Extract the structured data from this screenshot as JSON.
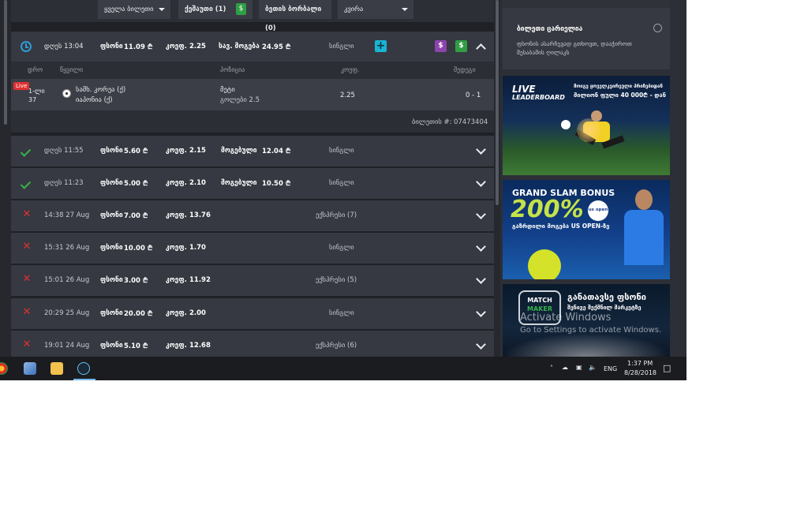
{
  "filters": [
    {
      "label": "ყველა ბილეთი"
    },
    {
      "label": "ქეშაუთი (1)"
    },
    {
      "label": "ბეთის ბორბალი (0)"
    },
    {
      "label": "კვირა"
    }
  ],
  "open_ticket": {
    "time": "დღეს 13:04",
    "stake_label": "ფსონი",
    "stake": "11.09 ₾",
    "odds_label": "კოეფ.",
    "odds": "2.25",
    "potential_label": "სავ. მოგება",
    "potential": "24.95 ₾",
    "type": "სინგლი",
    "columns": [
      "დრო",
      "წყვილი",
      "პოზიცია",
      "კოეფ.",
      "შედეგი"
    ],
    "match": {
      "live_badge": "Live",
      "period": "1-ლი",
      "minute": "37",
      "team1": "სამხ. კორეა (ქ)",
      "team2": "იაპონია (ქ)",
      "market": "მეტი",
      "selection": "გოლები 2.5",
      "odds": "2.25",
      "score": "0 - 1"
    },
    "ticket_label": "ბილეთის #:",
    "ticket_number": "07473404"
  },
  "tickets": [
    {
      "status": "won",
      "time": "დღეს 11:55",
      "stake": "5.60 ₾",
      "odds": "2.15",
      "result_label": "მოგებული",
      "result": "12.04 ₾",
      "type": "სინგლი"
    },
    {
      "status": "won",
      "time": "დღეს 11:23",
      "stake": "5.00 ₾",
      "odds": "2.10",
      "result_label": "მოგებული",
      "result": "10.50 ₾",
      "type": "სინგლი"
    },
    {
      "status": "lost",
      "time": "14:38 27 Aug",
      "stake": "7.00 ₾",
      "odds": "13.76",
      "result_label": "",
      "result": "",
      "type": "ექსპრესი (7)"
    },
    {
      "status": "lost",
      "time": "15:31 26 Aug",
      "stake": "10.00 ₾",
      "odds": "1.70",
      "result_label": "",
      "result": "",
      "type": "სინგლი"
    },
    {
      "status": "lost",
      "time": "15:01 26 Aug",
      "stake": "3.00 ₾",
      "odds": "11.92",
      "result_label": "",
      "result": "",
      "type": "ექსპრესი (5)"
    },
    {
      "status": "lost",
      "time": "20:29 25 Aug",
      "stake": "20.00 ₾",
      "odds": "2.00",
      "result_label": "",
      "result": "",
      "type": "სინგლი"
    },
    {
      "status": "lost",
      "time": "19:01 24 Aug",
      "stake": "5.10 ₾",
      "odds": "12.68",
      "result_label": "",
      "result": "",
      "type": "ექსპრესი (6)"
    }
  ],
  "stake_label": "ფსონი",
  "odds_label": "კოეფ.",
  "side": {
    "cart_title": "ბილეთი ცარიელია",
    "cart_text1": "ფსონის ასარჩევად გთხოვთ, დააჭიროთ",
    "cart_text2": "შესაბამის ღილაკს",
    "banner1_line1": "LIVE",
    "banner1_line2": "LEADERBOARD",
    "banner1_text1": "მოიგე ყოველკვირეული პრიზებიდან",
    "banner1_text2": "მილიონ ფული 40 000₾ - დან",
    "banner2_title": "GRAND SLAM BONUS",
    "banner2_percent": "200%",
    "banner2_badge": "us open",
    "banner2_sub": "გაზრდილი მოგება US OPEN-ზე",
    "banner3_logo1": "MATCH",
    "banner3_logo2": "MAKER",
    "banner3_title": "განათავსე ფსონი",
    "banner3_sub1": "შენივე შექმნილ მარკეტზე"
  },
  "watermark": {
    "line1": "Activate Windows",
    "line2": "Go to Settings to activate Windows."
  },
  "taskbar": {
    "lang": "ENG",
    "time": "1:37 PM",
    "date": "8/28/2018"
  }
}
